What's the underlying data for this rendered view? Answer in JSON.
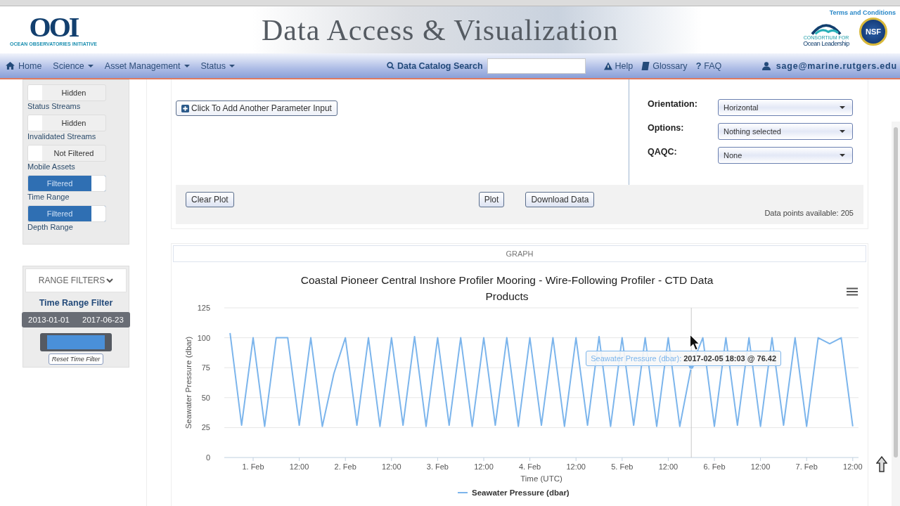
{
  "header": {
    "logo": {
      "mark": "OOI",
      "caption": "OCEAN OBSERVATORIES INITIATIVE"
    },
    "title": "Data Access & Visualization",
    "partner_logo": {
      "top": "CONSORTIUM FOR",
      "name": "Ocean Leadership"
    },
    "nsf_logo": "NSF",
    "terms_link": "Terms and Conditions"
  },
  "nav": {
    "items": [
      {
        "label": "Home",
        "dropdown": false
      },
      {
        "label": "Science",
        "dropdown": true
      },
      {
        "label": "Asset Management",
        "dropdown": true
      },
      {
        "label": "Status",
        "dropdown": true
      }
    ],
    "search": {
      "label": "Data Catalog Search"
    },
    "links": [
      {
        "label": "Help"
      },
      {
        "label": "Glossary"
      },
      {
        "label": "FAQ",
        "glyph": "?"
      }
    ],
    "user": "sage@marine.rutgers.edu"
  },
  "sidebar": {
    "toggles": [
      {
        "state": "Hidden",
        "on": false,
        "label": "Status Streams"
      },
      {
        "state": "Hidden",
        "on": false,
        "label": "Invalidated Streams"
      },
      {
        "state": "Not Filtered",
        "on": false,
        "label": "Mobile Assets"
      },
      {
        "state": "Filtered",
        "on": true,
        "label": "Time Range"
      },
      {
        "state": "Filtered",
        "on": true,
        "label": "Depth Range"
      }
    ],
    "range_filters": {
      "header": "RANGE FILTERS",
      "expanded": true,
      "title": "Time Range Filter",
      "from": "2013-01-01",
      "to": "2017-06-23",
      "level": 1,
      "reset": "Reset Time Filter"
    }
  },
  "plot_form": {
    "add_parameter": "Click To Add Another Parameter Input",
    "settings": [
      {
        "label": "Orientation:",
        "value": "Horizontal"
      },
      {
        "label": "Options:",
        "value": "Nothing selected"
      },
      {
        "label": "QAQC:",
        "value": "None"
      }
    ],
    "buttons": [
      "Clear Plot",
      "Plot",
      "Download Data"
    ],
    "data_points": "Data points available: 205"
  },
  "graph": {
    "header": "GRAPH",
    "chart_data": {
      "type": "line",
      "title": "Coastal Pioneer Central Inshore Profiler Mooring - Wire-Following Profiler - CTD Data Products",
      "xlabel": "Time (UTC)",
      "ylabel": "Seawater Pressure (dbar)",
      "categories": [
        null,
        null,
        "1. Feb",
        null,
        null,
        null,
        "12:00",
        null,
        null,
        null,
        "2. Feb",
        null,
        null,
        null,
        "12:00",
        null,
        null,
        null,
        "3. Feb",
        null,
        null,
        null,
        "12:00",
        null,
        null,
        null,
        "4. Feb",
        null,
        null,
        null,
        "12:00",
        null,
        null,
        null,
        "5. Feb",
        null,
        null,
        null,
        "12:00",
        null,
        null,
        null,
        "6. Feb",
        null,
        null,
        null,
        "12:00",
        null,
        null,
        null,
        "7. Feb",
        null,
        null,
        null,
        "12:00"
      ],
      "series": [
        {
          "name": "Seawater Pressure (dbar)",
          "color": "#7cb5ec",
          "values": [
            104,
            27,
            100,
            26,
            100,
            100,
            27,
            100,
            26,
            70,
            100,
            27,
            100,
            26,
            100,
            27,
            101,
            26,
            100,
            27,
            100,
            26,
            100,
            27,
            100,
            26,
            100,
            27,
            100,
            26,
            100,
            27,
            101,
            26,
            100,
            27,
            100,
            26,
            100,
            26,
            76,
            100,
            26,
            100,
            27,
            100,
            26,
            100,
            27,
            100,
            26,
            100,
            95,
            100,
            26
          ]
        }
      ],
      "ylim": [
        0,
        125
      ],
      "grid": true,
      "yticks": [
        0,
        25,
        50,
        75,
        100,
        125
      ],
      "annotations": [
        "Seawater Pressure (dbar): **2017-02-05 18:03 @ 76.42**"
      ]
    }
  }
}
